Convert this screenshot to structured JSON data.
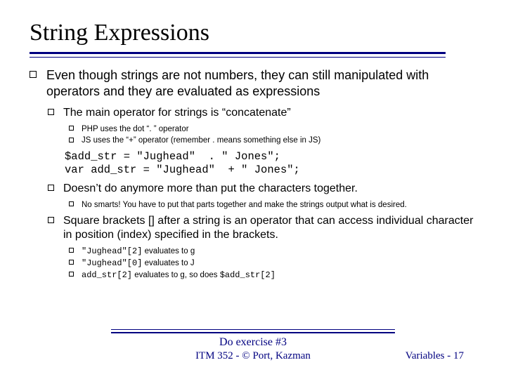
{
  "title": "String Expressions",
  "b1": "Even though strings are not numbers, they can still manipulated with operators and they are evaluated as expressions",
  "b2a": "The main operator for strings is “concatenate”",
  "b3a": "PHP uses the dot “. ” operator",
  "b3b": "JS uses the “+” operator (remember . means something else in JS)",
  "code": "$add_str = \"Jughead\"  . \" Jones\";\nvar add_str = \"Jughead\"  + \" Jones\";",
  "b2b": "Doesn’t do anymore more than put the characters together.",
  "b3c": "No smarts! You have to put that parts together and make the strings output what is desired.",
  "b2c": "Square brackets [] after a string is an operator that can access individual character in position (index) specified in the brackets.",
  "ev1_code": "\"Jughead\"[2]",
  "ev1_tail": "  evaluates to g",
  "ev2_code": "\"Jughead\"[0]",
  "ev2_tail": "  evaluates to J",
  "ev3_code": "add_str[2]",
  "ev3_tail": "  evaluates to g, so does ",
  "ev3_code2": "$add_str[2]",
  "footer_exercise": "Do exercise #3",
  "footer_center": "ITM 352 - © Port, Kazman",
  "footer_right": "Variables - 17"
}
